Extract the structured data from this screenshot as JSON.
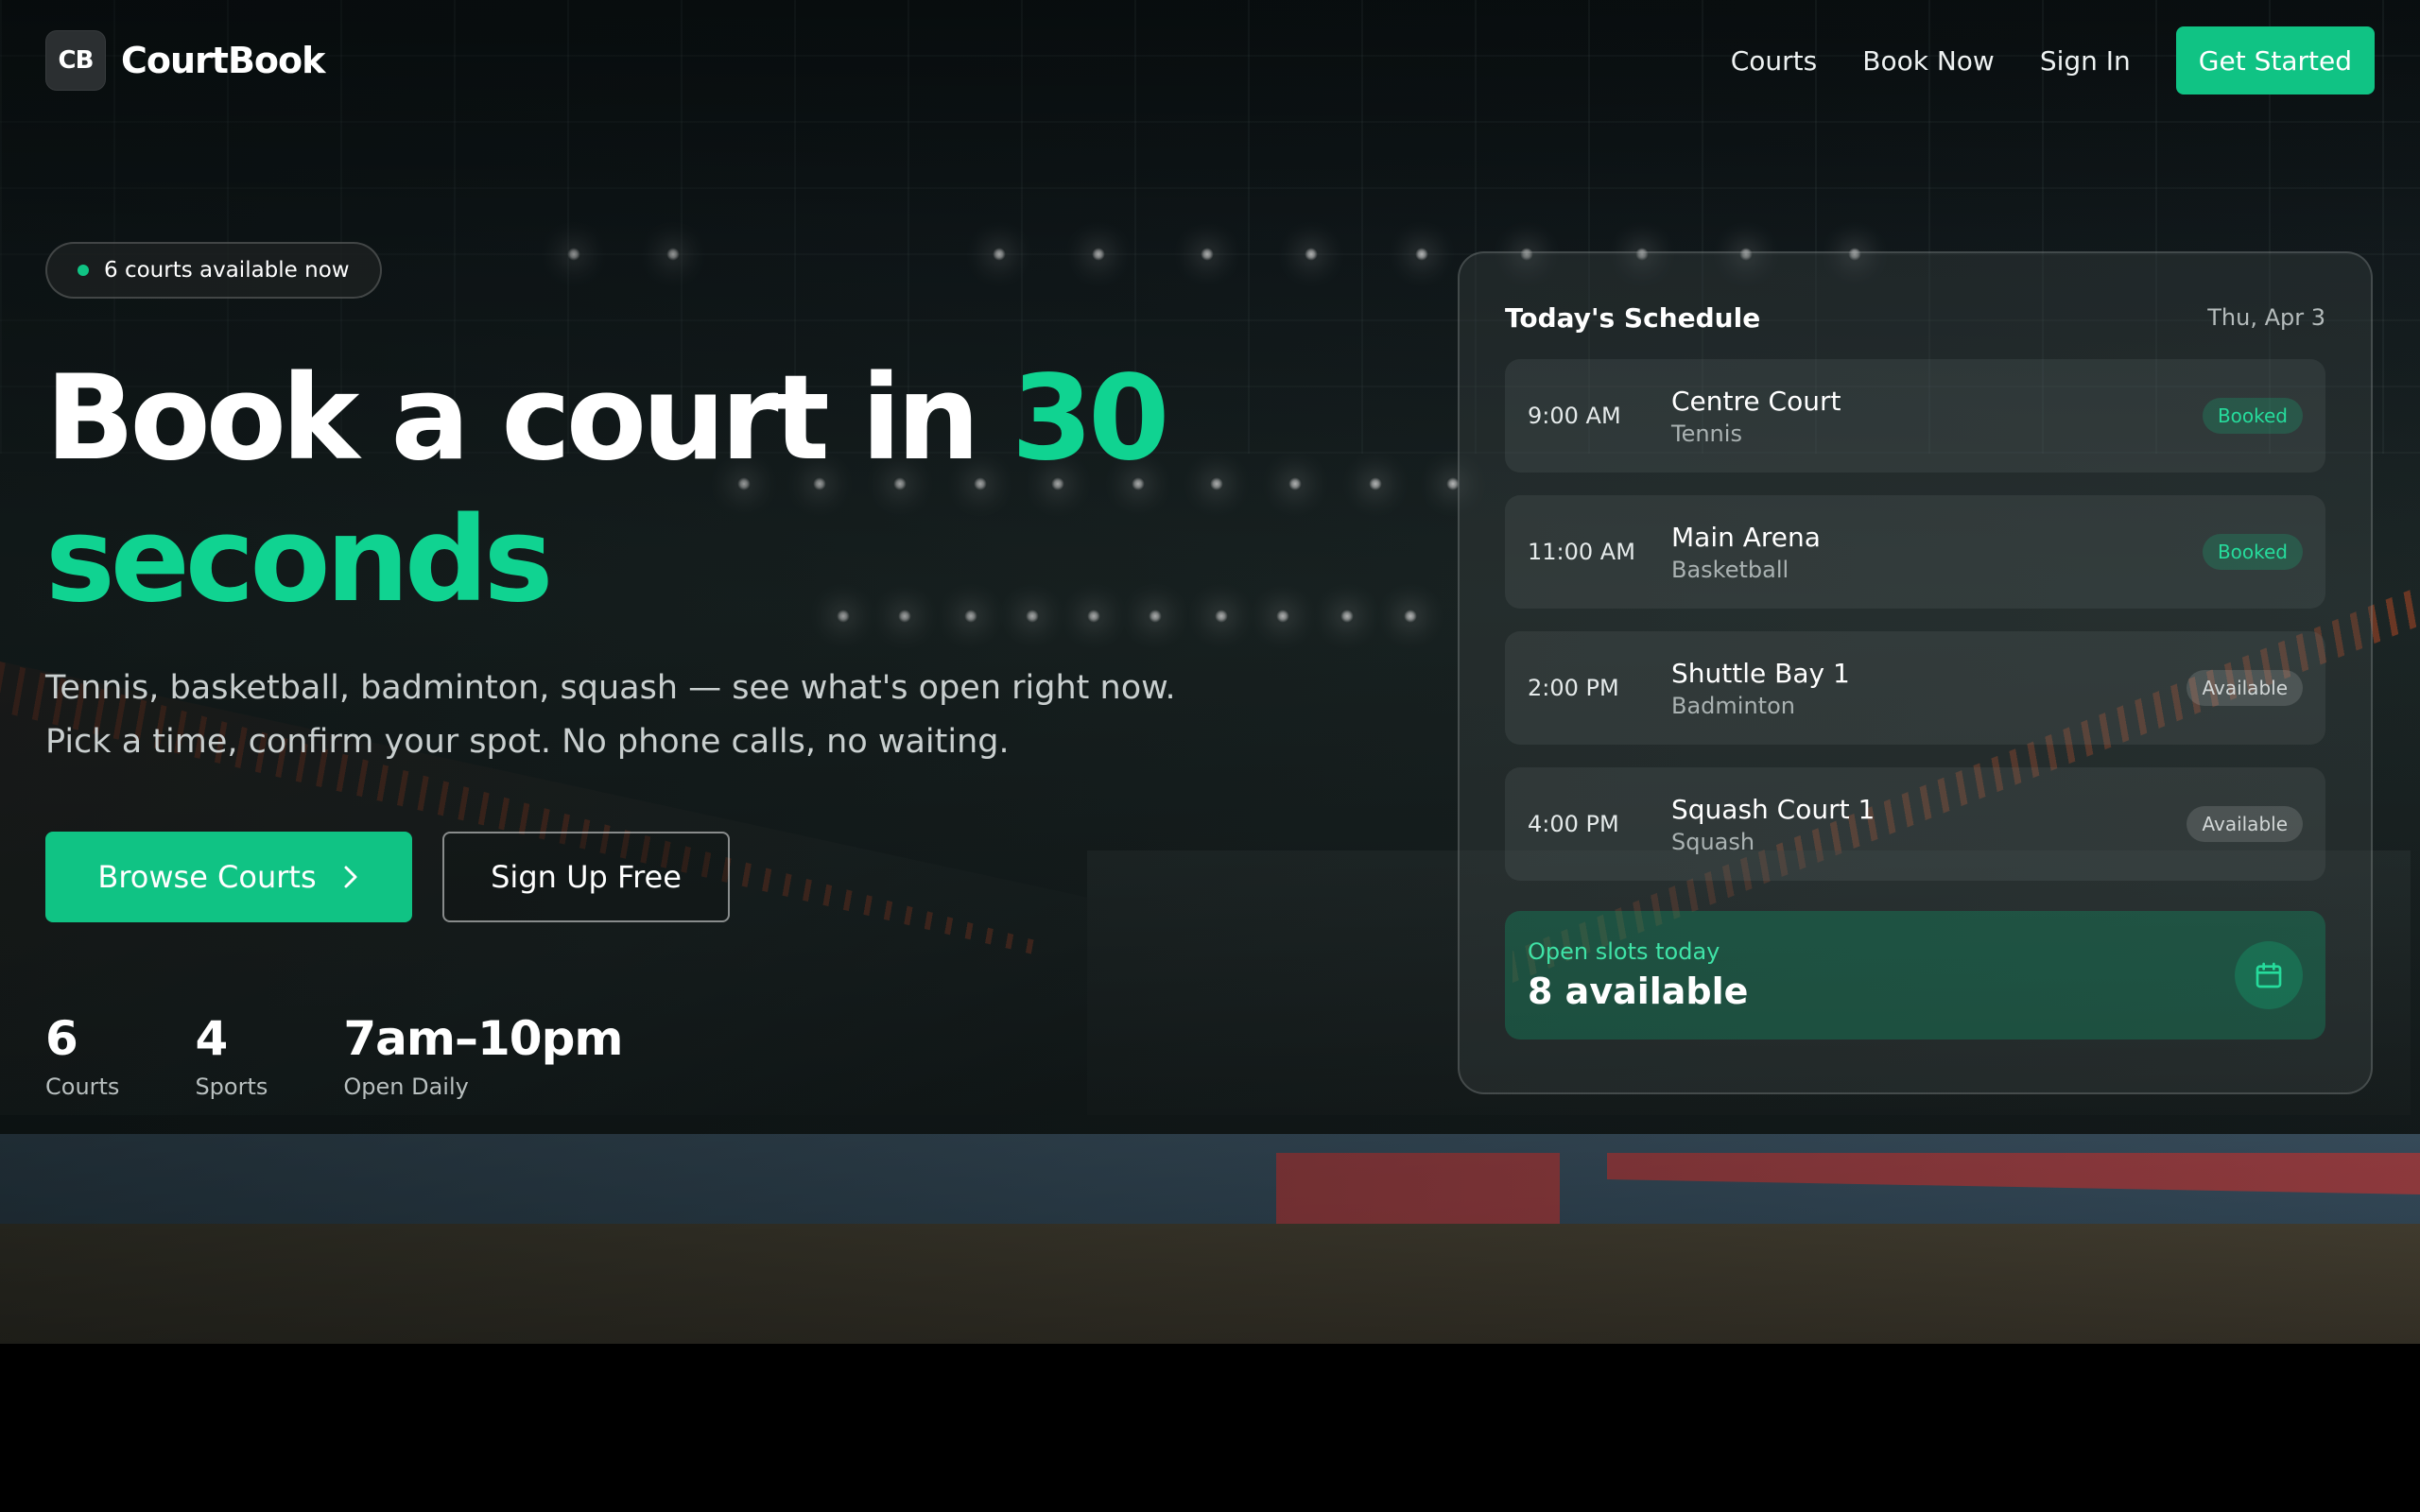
{
  "brand": {
    "logo_text": "CB",
    "name": "CourtBook"
  },
  "nav": {
    "links": [
      "Courts",
      "Book Now",
      "Sign In"
    ],
    "cta": "Get Started"
  },
  "hero": {
    "badge": "6 courts available now",
    "headline_main": "Book a court in ",
    "headline_accent": "30 seconds",
    "subtext_line1": "Tennis, basketball, badminton, squash — see what's open right now.",
    "subtext_line2": "Pick a time, confirm your spot. No phone calls, no waiting.",
    "browse_label": "Browse Courts",
    "signup_label": "Sign Up Free",
    "stats": [
      {
        "value": "6",
        "label": "Courts"
      },
      {
        "value": "4",
        "label": "Sports"
      },
      {
        "value": "7am–10pm",
        "label": "Open Daily"
      }
    ]
  },
  "schedule": {
    "title": "Today's Schedule",
    "date": "Thu, Apr 3",
    "slots": [
      {
        "time": "9:00 AM",
        "court": "Centre Court",
        "sport": "Tennis",
        "status": "Booked"
      },
      {
        "time": "11:00 AM",
        "court": "Main Arena",
        "sport": "Basketball",
        "status": "Booked"
      },
      {
        "time": "2:00 PM",
        "court": "Shuttle Bay 1",
        "sport": "Badminton",
        "status": "Available"
      },
      {
        "time": "4:00 PM",
        "court": "Squash Court 1",
        "sport": "Squash",
        "status": "Available"
      }
    ],
    "open_label": "Open slots today",
    "open_value": "8 available"
  },
  "icons": {
    "chevron": "chevron-right-icon",
    "calendar": "calendar-icon"
  },
  "colors": {
    "accent": "#10c384",
    "accent_text": "#10d391"
  }
}
